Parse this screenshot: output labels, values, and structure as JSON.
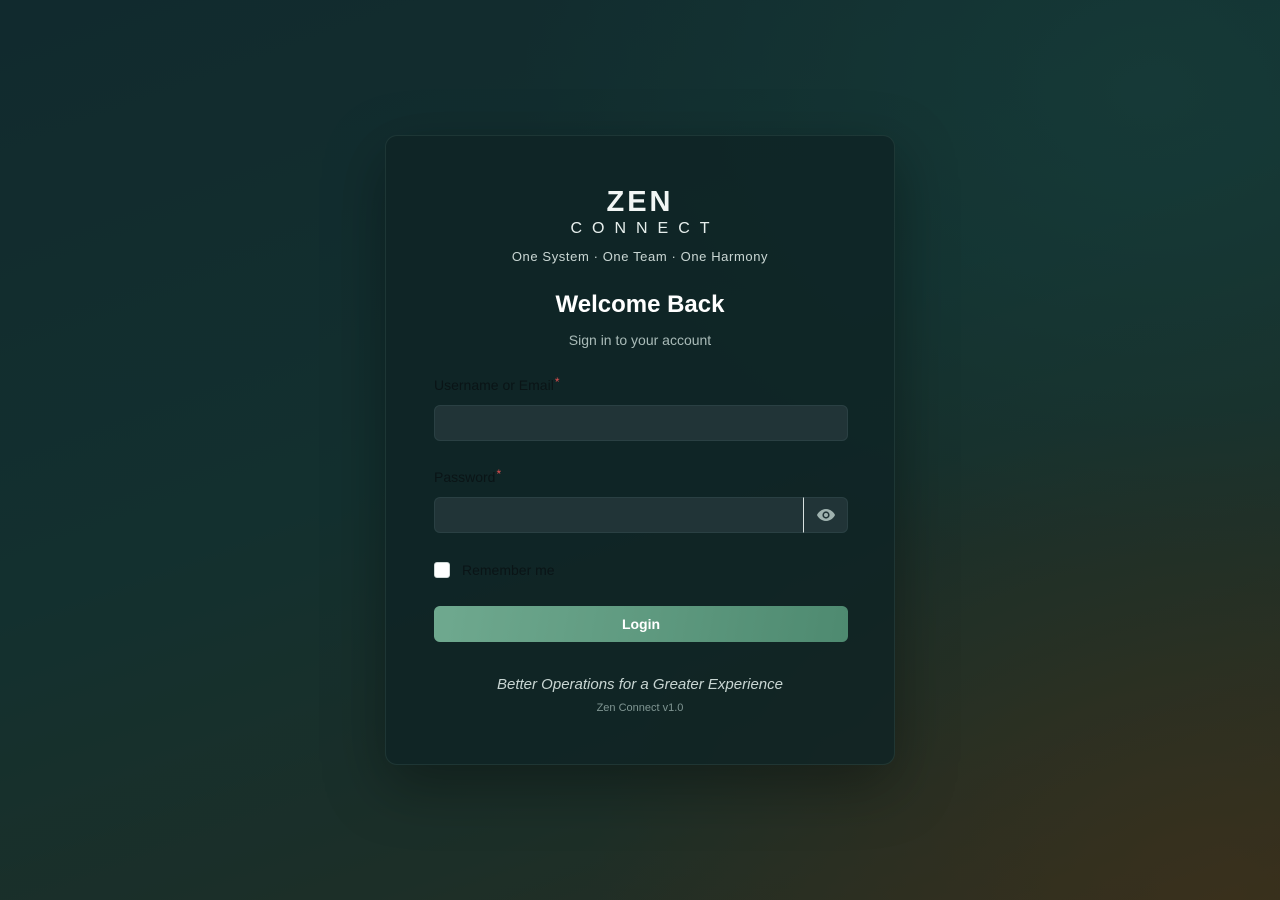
{
  "brand": {
    "name_top": "ZEN",
    "name_bottom": "CONNECT",
    "tagline": "One System · One Team · One Harmony"
  },
  "header": {
    "title": "Welcome Back",
    "subtitle": "Sign in to your account"
  },
  "form": {
    "username_label": "Username or Email",
    "username_value": "",
    "username_placeholder": "",
    "password_label": "Password",
    "password_value": "",
    "password_placeholder": "",
    "required_marker": "*",
    "remember_label": "Remember me",
    "remember_checked": false,
    "password_toggle_icon": "eye-icon",
    "login_label": "Login"
  },
  "footer": {
    "motto": "Better Operations for a Greater Experience",
    "version": "Zen Connect v1.0"
  },
  "colors": {
    "accent": "#5f9a80",
    "required": "#e05050",
    "card_bg": "#0e2224"
  }
}
